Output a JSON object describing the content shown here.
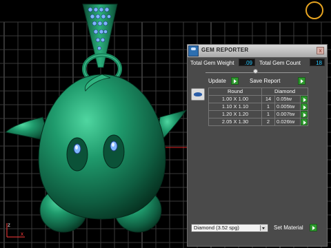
{
  "panel": {
    "title": "GEM REPORTER",
    "close_label": "x",
    "total_weight_label": "Total Gem Weight",
    "total_weight_value": ".09",
    "total_count_label": "Total Gem Count",
    "total_count_value": "18",
    "update_label": "Update",
    "save_report_label": "Save Report",
    "table": {
      "headers": [
        "Round",
        "Diamond"
      ],
      "rows": [
        {
          "size": "1.00 X 1.00",
          "count": "14",
          "weight": "0.05tw"
        },
        {
          "size": "1.10 X 1.10",
          "count": "1",
          "weight": "0.005tw"
        },
        {
          "size": "1.20 X 1.20",
          "count": "1",
          "weight": "0.007tw"
        },
        {
          "size": "2.05 X 1.30",
          "count": "2",
          "weight": "0.026tw"
        }
      ]
    },
    "material_selected": "Diamond    (3.52 spg)",
    "set_material_label": "Set Material"
  },
  "viewport": {
    "axis_z": "z",
    "axis_x": "x",
    "model_color": "#1a7a57",
    "gem_color": "#7fb6ff",
    "nav_ring_color": "#e8a521"
  }
}
